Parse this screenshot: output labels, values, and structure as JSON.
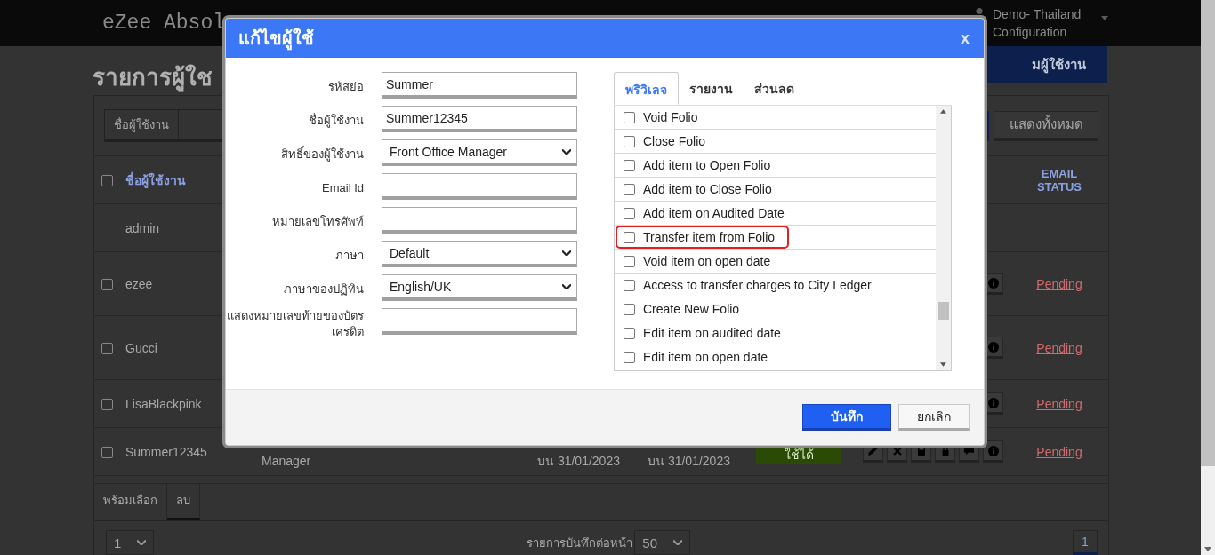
{
  "topbar": {
    "brand": "eZee Absol",
    "account_line1": "Demo- Thailand",
    "account_line2": "Configuration"
  },
  "page": {
    "title": "รายการผู้ใช",
    "add_button": "มผู้ใช้งาน",
    "search_tab": "ชื่อผู้ใช้งาน",
    "show_all": "แสดงทั้งหมด",
    "header": {
      "checked": false,
      "name": "ชื่อผู้ใช้งาน",
      "email_status": "EMAIL STATUS"
    },
    "rows": [
      {
        "name": "admin",
        "actions": []
      },
      {
        "name": "ezee",
        "checked": false,
        "actions": [
          {
            "kind": "info"
          }
        ],
        "email_status": "Pending"
      },
      {
        "name": "Gucci",
        "checked": false,
        "actions": [
          {
            "kind": "info"
          }
        ],
        "email_status": "Pending"
      },
      {
        "name": "LisaBlackpink",
        "checked": false,
        "actions": [
          {
            "kind": "info"
          }
        ],
        "email_status": "Pending"
      },
      {
        "name": "Summer12345",
        "checked": false,
        "role": "Manager",
        "created": "บน 31/01/2023",
        "modified": "บน 31/01/2023",
        "status": "ใช้ได้",
        "actions": [
          {
            "kind": "edit"
          },
          {
            "kind": "delete"
          },
          {
            "kind": "calculator"
          },
          {
            "kind": "lock"
          },
          {
            "kind": "comment"
          },
          {
            "kind": "info"
          }
        ],
        "email_status": "Pending"
      }
    ],
    "footer_tabs": [
      {
        "label": "พร้อมเลือก",
        "selected": false
      },
      {
        "label": "ลบ",
        "selected": true
      }
    ],
    "page_select": "1",
    "per_page_label": "รายการบันทึกต่อหน้า",
    "per_page": "50",
    "current_page": "1"
  },
  "modal": {
    "title": "แก้ไขผู้ใช้",
    "close": "x",
    "fields": [
      {
        "label": "รหัสย่อ",
        "kind": "text",
        "value": "Summer"
      },
      {
        "label": "ชื่อผู้ใช้งาน",
        "kind": "text",
        "value": "Summer12345"
      },
      {
        "label": "สิทธิ์ของผู้ใช้งาน",
        "kind": "select",
        "value": "Front Office Manager"
      },
      {
        "label": "Email Id",
        "kind": "text"
      },
      {
        "label": "หมายเลขโทรศัพท์",
        "kind": "text"
      },
      {
        "label": "ภาษา",
        "kind": "select",
        "value": "Default"
      },
      {
        "label": "ภาษาของปฏิทิน",
        "kind": "select",
        "value": "English/UK"
      },
      {
        "label": "แสดงหมายเลขท้ายของบัตรเครดิต",
        "kind": "text"
      }
    ],
    "tabs": [
      {
        "label": "พริวิเลจ",
        "selected": true
      },
      {
        "label": "รายงาน",
        "selected": false
      },
      {
        "label": "ส่วนลด",
        "selected": false
      }
    ],
    "privileges": [
      {
        "label": "Void Folio",
        "checked": false,
        "highlighted": false
      },
      {
        "label": "Close Folio",
        "checked": false,
        "highlighted": false
      },
      {
        "label": "Add item to Open Folio",
        "checked": false,
        "highlighted": false
      },
      {
        "label": "Add item to Close Folio",
        "checked": false,
        "highlighted": false
      },
      {
        "label": "Add item on Audited Date",
        "checked": false,
        "highlighted": false
      },
      {
        "label": "Transfer item from Folio",
        "checked": false,
        "highlighted": true
      },
      {
        "label": "Void item on open date",
        "checked": false,
        "highlighted": false
      },
      {
        "label": "Access to transfer charges to City Ledger",
        "checked": false,
        "highlighted": false
      },
      {
        "label": "Create New Folio",
        "checked": false,
        "highlighted": false
      },
      {
        "label": "Edit item on audited date",
        "checked": false,
        "highlighted": false
      },
      {
        "label": "Edit item on open date",
        "checked": false,
        "highlighted": false
      }
    ],
    "save": "บันทึก",
    "cancel": "ยกเลิก"
  }
}
